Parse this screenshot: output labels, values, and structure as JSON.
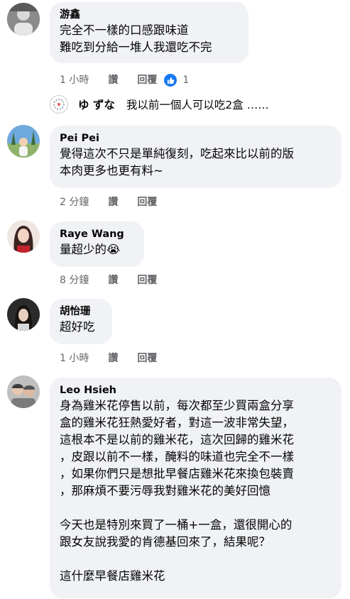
{
  "comments": [
    {
      "name": "游鑫",
      "text": "完全不一樣的口感跟味道\n難吃到分給一堆人我還吃不完",
      "time": "1 小時",
      "like_label": "讚",
      "reply_label": "回覆",
      "reaction_count": "1"
    },
    {
      "name": "Pei Pei",
      "text": "覺得這次不只是單純復刻，吃起來比以前的版\n本肉更多也更有料~",
      "time": "2 分鐘",
      "like_label": "讚",
      "reply_label": "回覆"
    },
    {
      "name": "Raye Wang",
      "text": "量超少的😭",
      "time": "8 分鐘",
      "like_label": "讚",
      "reply_label": "回覆"
    },
    {
      "name": "胡怡珊",
      "text": "超好吃",
      "time": "1 小時",
      "like_label": "讚",
      "reply_label": "回覆"
    },
    {
      "name": "Leo Hsieh",
      "text": "身為雞米花停售以前，每次都至少買兩盒分享\n盒的雞米花狂熱愛好者，對這一波非常失望，\n這根本不是以前的雞米花，這次回歸的雞米花\n，皮跟以前不一樣，醃料的味道也完全不一樣\n，如果你們只是想批早餐店雞米花來換包裝賣\n，那麻煩不要污辱我對雞米花的美好回憶\n\n今天也是特別來買了一桶+一盒，還很開心的\n跟女友說我愛的肯德基回來了，結果呢？\n\n這什麼早餐店雞米花"
    }
  ],
  "reply_preview": {
    "name": "ゆ ずな",
    "text": "我以前一個人可以吃2盒 ……"
  },
  "colors": {
    "bubble": "#f0f2f5",
    "meta_text": "#65676b",
    "like_blue": "#1877f2"
  }
}
